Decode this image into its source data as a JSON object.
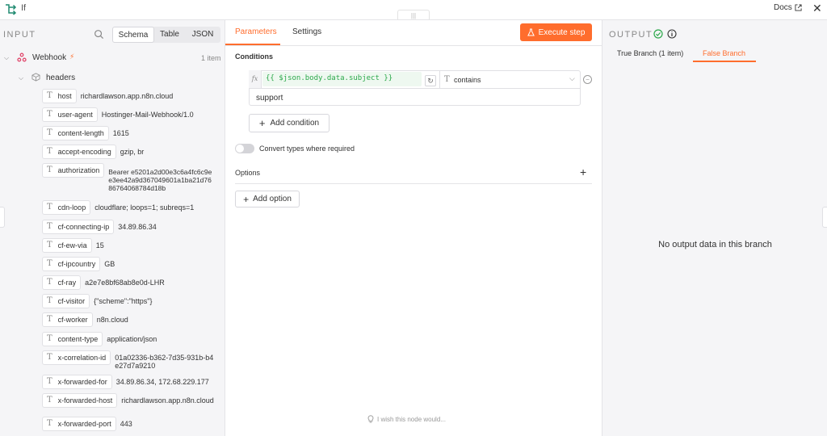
{
  "header": {
    "node_title": "If",
    "docs_label": "Docs",
    "drag_handle": "|||"
  },
  "input_panel": {
    "label": "INPUT",
    "modes": [
      "Schema",
      "Table",
      "JSON"
    ],
    "active_mode": "Schema",
    "webhook": {
      "label": "Webhook",
      "item_count": "1 item"
    },
    "headers_label": "headers",
    "fields": [
      {
        "key": "host",
        "value": "richardlawson.app.n8n.cloud"
      },
      {
        "key": "user-agent",
        "value": "Hostinger-Mail-Webhook/1.0"
      },
      {
        "key": "content-length",
        "value": "1615"
      },
      {
        "key": "accept-encoding",
        "value": "gzip, br"
      },
      {
        "key": "authorization",
        "value": "Bearer e5201a2d00e3c6a4fc6c9ee3ee42a9d367049601a1ba21d7686764068784d18b"
      },
      {
        "key": "cdn-loop",
        "value": "cloudflare; loops=1; subreqs=1"
      },
      {
        "key": "cf-connecting-ip",
        "value": "34.89.86.34"
      },
      {
        "key": "cf-ew-via",
        "value": "15"
      },
      {
        "key": "cf-ipcountry",
        "value": "GB"
      },
      {
        "key": "cf-ray",
        "value": "a2e7e8bf68ab8e0d-LHR"
      },
      {
        "key": "cf-visitor",
        "value": "{\"scheme\":\"https\"}"
      },
      {
        "key": "cf-worker",
        "value": "n8n.cloud"
      },
      {
        "key": "content-type",
        "value": "application/json"
      },
      {
        "key": "x-correlation-id",
        "value": "01a02336-b362-7d35-931b-b4e27d7a9210"
      },
      {
        "key": "x-forwarded-for",
        "value": "34.89.86.34, 172.68.229.177"
      },
      {
        "key": "x-forwarded-host",
        "value": "richardlawson.app.n8n.cloud"
      },
      {
        "key": "x-forwarded-port",
        "value": "443"
      }
    ]
  },
  "params_panel": {
    "tabs": [
      "Parameters",
      "Settings"
    ],
    "active_tab": "Parameters",
    "execute_label": "Execute step",
    "conditions_label": "Conditions",
    "condition": {
      "fx_label": "fx",
      "left_value": "{{ $json.body.data.subject }}",
      "operator": "contains",
      "right_value": "support"
    },
    "add_condition_label": "Add condition",
    "convert_types_label": "Convert types where required",
    "convert_types_enabled": false,
    "options_label": "Options",
    "add_option_label": "Add option",
    "wish_label": "I wish this node would..."
  },
  "output_panel": {
    "label": "OUTPUT",
    "tabs": [
      "True Branch (1 item)",
      "False Branch"
    ],
    "active_tab": "False Branch",
    "empty_message": "No output data in this branch"
  },
  "colors": {
    "accent": "#ff6d2d",
    "success": "#2ba84a",
    "panel_bg": "#f5f5f7"
  }
}
